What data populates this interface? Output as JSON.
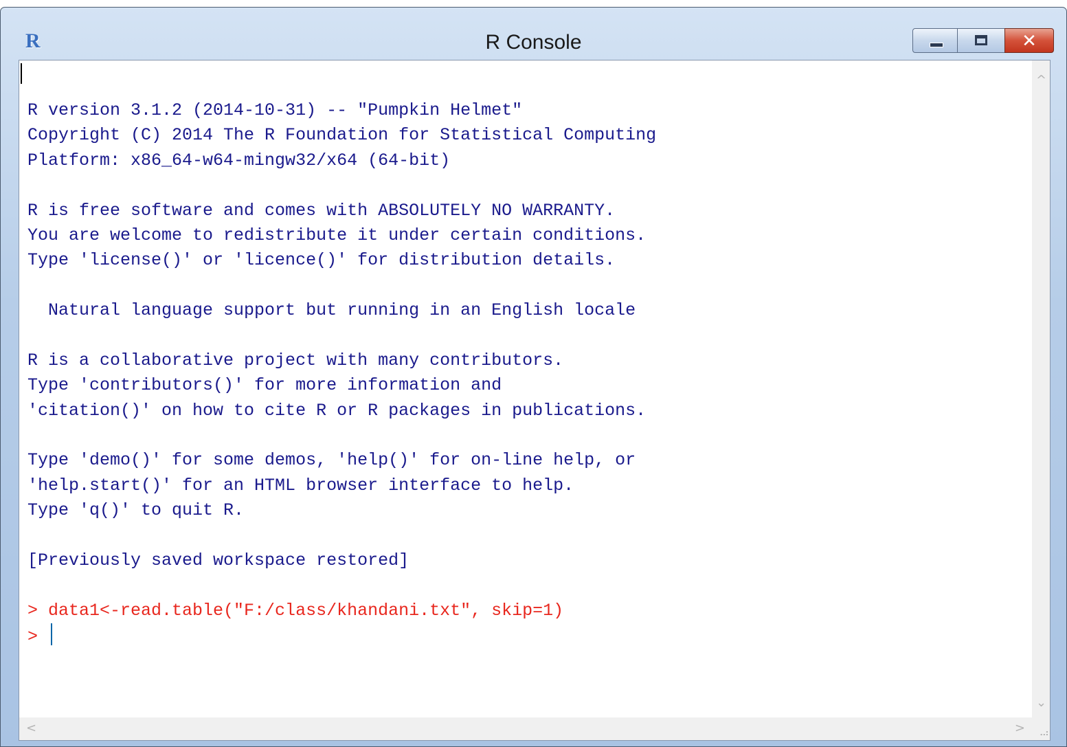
{
  "window": {
    "title": "R Console",
    "app_icon": "R",
    "close_glyph": "✕"
  },
  "console": {
    "lines": [
      {
        "text": "R version 3.1.2 (2014-10-31) -- \"Pumpkin Helmet\"",
        "kind": "output"
      },
      {
        "text": "Copyright (C) 2014 The R Foundation for Statistical Computing",
        "kind": "output"
      },
      {
        "text": "Platform: x86_64-w64-mingw32/x64 (64-bit)",
        "kind": "output"
      },
      {
        "text": "",
        "kind": "output"
      },
      {
        "text": "R is free software and comes with ABSOLUTELY NO WARRANTY.",
        "kind": "output"
      },
      {
        "text": "You are welcome to redistribute it under certain conditions.",
        "kind": "output"
      },
      {
        "text": "Type 'license()' or 'licence()' for distribution details.",
        "kind": "output"
      },
      {
        "text": "",
        "kind": "output"
      },
      {
        "text": "  Natural language support but running in an English locale",
        "kind": "output"
      },
      {
        "text": "",
        "kind": "output"
      },
      {
        "text": "R is a collaborative project with many contributors.",
        "kind": "output"
      },
      {
        "text": "Type 'contributors()' for more information and",
        "kind": "output"
      },
      {
        "text": "'citation()' on how to cite R or R packages in publications.",
        "kind": "output"
      },
      {
        "text": "",
        "kind": "output"
      },
      {
        "text": "Type 'demo()' for some demos, 'help()' for on-line help, or",
        "kind": "output"
      },
      {
        "text": "'help.start()' for an HTML browser interface to help.",
        "kind": "output"
      },
      {
        "text": "Type 'q()' to quit R.",
        "kind": "output"
      },
      {
        "text": "",
        "kind": "output"
      },
      {
        "text": "[Previously saved workspace restored]",
        "kind": "output"
      },
      {
        "text": "",
        "kind": "output"
      },
      {
        "text": "> data1<-read.table(\"F:/class/khandani.txt\", skip=1)",
        "kind": "cmd"
      }
    ],
    "prompt": "> "
  },
  "scrollbars": {
    "up": "^",
    "down": "⌄",
    "left": "<",
    "right": ">",
    "grip": "⠠⠴"
  },
  "colors": {
    "output_text": "#1a1a8c",
    "command_text": "#e8271e",
    "caret": "#0066a8"
  },
  "icons": [
    "r-logo-icon",
    "minimize-icon",
    "maximize-icon",
    "close-icon",
    "scroll-up-icon",
    "scroll-down-icon",
    "scroll-left-icon",
    "scroll-right-icon",
    "resize-grip-icon"
  ]
}
